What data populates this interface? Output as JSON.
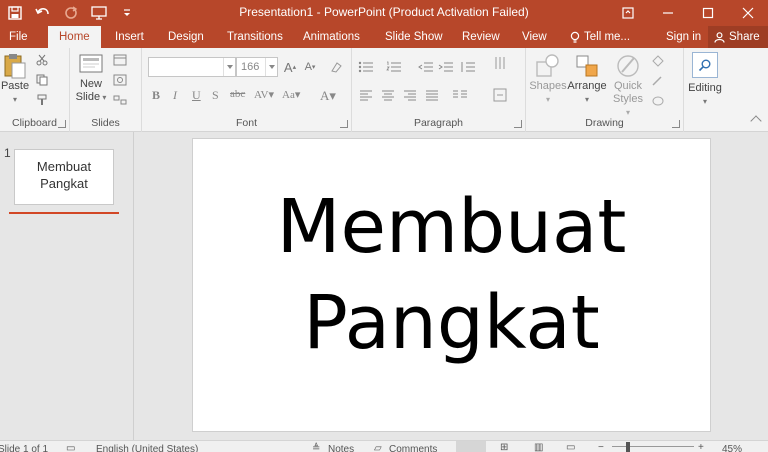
{
  "window": {
    "title": "Presentation1 - PowerPoint (Product Activation Failed)",
    "accent": "#b7472a"
  },
  "qat": {
    "icons": [
      "save-icon",
      "undo-icon",
      "redo-icon",
      "slideshow-from-start-icon",
      "customize-qat-icon"
    ]
  },
  "tabs": [
    {
      "label": "File"
    },
    {
      "label": "Home"
    },
    {
      "label": "Insert"
    },
    {
      "label": "Design"
    },
    {
      "label": "Transitions"
    },
    {
      "label": "Animations"
    },
    {
      "label": "Slide Show"
    },
    {
      "label": "Review"
    },
    {
      "label": "View"
    }
  ],
  "tellme": {
    "label": "Tell me..."
  },
  "account": {
    "signin": "Sign in",
    "share": "Share"
  },
  "ribbon": {
    "clipboard": {
      "label": "Clipboard",
      "paste": "Paste"
    },
    "slides": {
      "label": "Slides",
      "new_slide_line1": "New",
      "new_slide_line2": "Slide"
    },
    "font": {
      "label": "Font",
      "font_name": "",
      "font_size": "166"
    },
    "paragraph": {
      "label": "Paragraph"
    },
    "drawing": {
      "label": "Drawing",
      "shapes": "Shapes",
      "arrange": "Arrange",
      "quick_styles_line1": "Quick",
      "quick_styles_line2": "Styles"
    },
    "editing": {
      "label": "Editing"
    }
  },
  "thumbnails": [
    {
      "number": "1",
      "line1": "Membuat",
      "line2": "Pangkat"
    }
  ],
  "slide": {
    "title_line1": "Membuat",
    "title_line2": "Pangkat"
  },
  "status": {
    "slide_count": "Slide 1 of 1",
    "language": "English (United States)",
    "notes": "Notes",
    "comments": "Comments",
    "zoom": "45%"
  }
}
